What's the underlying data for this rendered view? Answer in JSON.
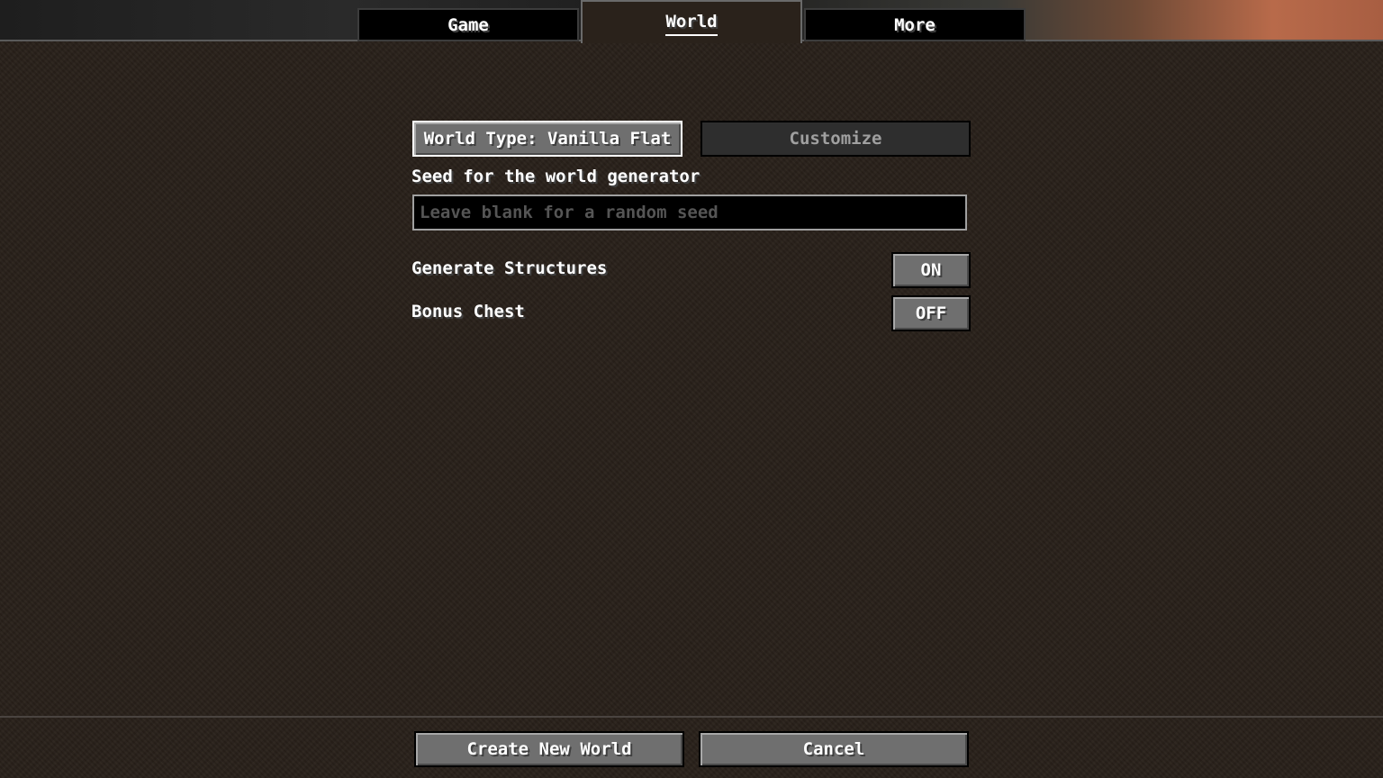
{
  "tabs": [
    {
      "label": "Game",
      "active": false
    },
    {
      "label": "World",
      "active": true
    },
    {
      "label": "More",
      "active": false
    }
  ],
  "world": {
    "world_type_button": "World Type: Vanilla Flat",
    "customize_button": "Customize",
    "seed_label": "Seed for the world generator",
    "seed_value": "",
    "seed_placeholder": "Leave blank for a random seed",
    "generate_structures_label": "Generate Structures",
    "generate_structures_value": "ON",
    "bonus_chest_label": "Bonus Chest",
    "bonus_chest_value": "OFF"
  },
  "footer": {
    "create_button": "Create New World",
    "cancel_button": "Cancel"
  },
  "colors": {
    "background": "#2a221b",
    "button": "#6f6f6f",
    "disabled_button": "#2e2e2e",
    "text": "#ffffff",
    "placeholder_text": "#555555"
  }
}
